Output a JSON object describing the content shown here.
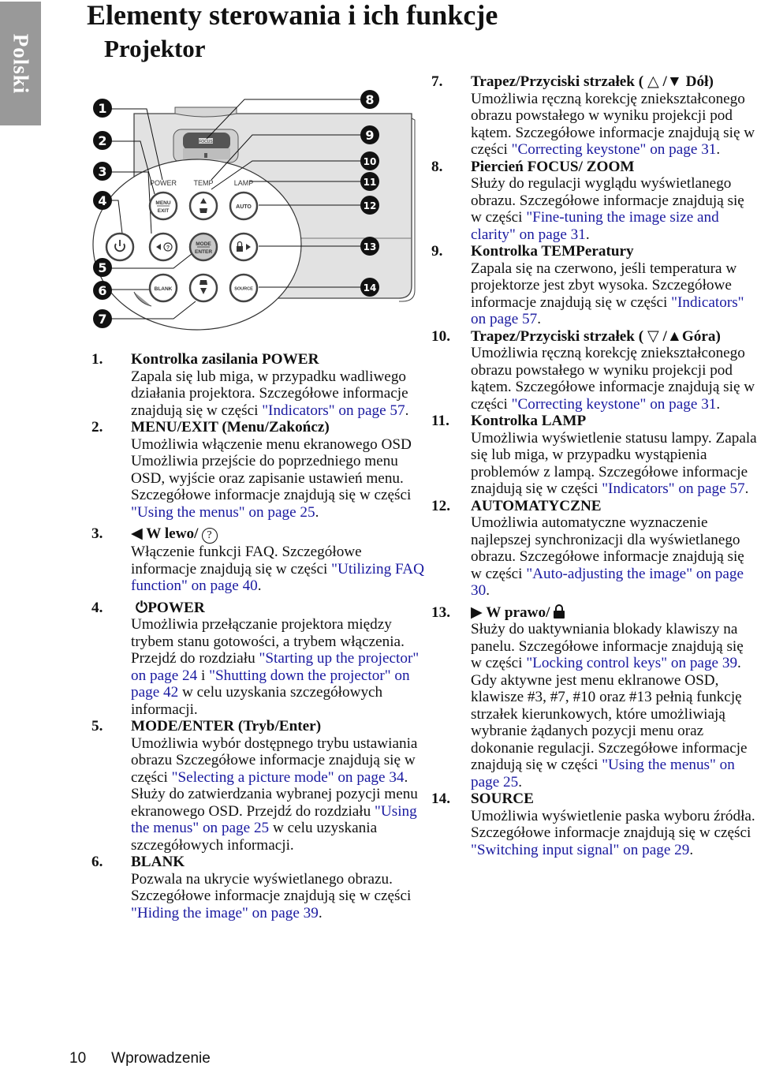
{
  "sidebar": {
    "language_tab": "Polski"
  },
  "header": {
    "title": "Elementy sterowania i ich funkcje",
    "subtitle": "Projektor"
  },
  "diagram": {
    "panel_labels": {
      "power": "POWER",
      "temp": "TEMP",
      "lamp": "LAMP",
      "focus": "FOCUS"
    },
    "buttons": {
      "menu_top": "MENU",
      "menu_bottom": "EXIT",
      "auto": "AUTO",
      "mode_top": "MODE",
      "mode_bottom": "ENTER",
      "blank": "BLANK",
      "source": "SOURCE"
    },
    "callouts": [
      "1",
      "2",
      "3",
      "4",
      "5",
      "6",
      "7",
      "8",
      "9",
      "10",
      "11",
      "12",
      "13",
      "14"
    ]
  },
  "items": [
    {
      "num": "1.",
      "title": "Kontrolka zasilania POWER",
      "body": "Zapala się lub miga, w przypadku wadliwego działania projektora. Szczegółowe informacje znajdują się w części ",
      "link": "\"Indicators\" on page 57",
      "tail": "."
    },
    {
      "num": "2.",
      "title": "MENU/EXIT (Menu/Zakończ)",
      "body": "Umożliwia włączenie menu ekranowego OSD Umożliwia przejście do poprzedniego menu OSD, wyjście oraz zapisanie ustawień menu.",
      "body2": "Szczegółowe informacje znajdują się w części ",
      "link": "\"Using the menus\" on page 25",
      "tail": "."
    },
    {
      "num": "3.",
      "title": "W lewo/",
      "body": "Włączenie funkcji FAQ. Szczegółowe informacje znajdują się w części ",
      "link": "\"Utilizing FAQ function\" on page 40",
      "tail": "."
    },
    {
      "num": "4.",
      "title": "POWER",
      "body": "Umożliwia przełączanie projektora między trybem stanu gotowości, a trybem włączenia. Przejdź do rozdziału ",
      "link": "\"Starting up the projector\" on page 24",
      "mid": "  i ",
      "link2": "\"Shutting down the projector\" on page 42",
      "tail": " w celu uzyskania szczegółowych informacji."
    },
    {
      "num": "5.",
      "title": "MODE/ENTER (Tryb/Enter)",
      "body": "Umożliwia wybór dostępnego trybu ustawiania obrazu Szczegółowe informacje znajdują się w części ",
      "link": "\"Selecting a picture mode\" on page 34",
      "tail": ".",
      "body2": "Służy do zatwierdzania wybranej pozycji menu ekranowego OSD. Przejdź do rozdziału ",
      "link2": "\"Using the menus\" on page 25",
      "tail2": " w celu uzyskania szczegółowych informacji."
    },
    {
      "num": "6.",
      "title": "BLANK",
      "body": "Pozwala na ukrycie wyświetlanego obrazu. Szczegółowe informacje znajdują się w części ",
      "link": "\"Hiding the image\" on page 39",
      "tail": "."
    },
    {
      "num": "7.",
      "title_pre": "Trapez/Przyciski strzałek (",
      "title_post": " Dół)",
      "body": "Umożliwia ręczną korekcję zniekształconego obrazu powstałego w wyniku projekcji pod kątem. Szczegółowe informacje znajdują się w części ",
      "link": "\"Correcting keystone\" on page 31",
      "tail": "."
    },
    {
      "num": "8.",
      "title": "Piercień FOCUS/ ZOOM",
      "body": "Służy do regulacji wyglądu wyświetlanego obrazu. Szczegółowe informacje znajdują się w części ",
      "link": "\"Fine-tuning the image size and clarity\" on page 31",
      "tail": "."
    },
    {
      "num": "9.",
      "title": "Kontrolka TEMPeratury",
      "body": "Zapala się na czerwono, jeśli temperatura w projektorze jest zbyt wysoka. Szczegółowe informacje znajdują się w części ",
      "link": "\"Indicators\" on page 57",
      "tail": "."
    },
    {
      "num": "10.",
      "title_pre": "Trapez/Przyciski strzałek (",
      "title_post": "Góra)",
      "body": "Umożliwia ręczną korekcję zniekształconego obrazu powstałego w wyniku projekcji pod kątem. Szczegółowe informacje znajdują się w części ",
      "link": "\"Correcting keystone\" on page 31",
      "tail": "."
    },
    {
      "num": "11.",
      "title": "Kontrolka LAMP",
      "body": "Umożliwia wyświetlenie statusu lampy. Zapala się lub miga, w przypadku wystąpienia problemów z lampą. Szczegółowe informacje znajdują się w części ",
      "link": "\"Indicators\" on page 57",
      "tail": "."
    },
    {
      "num": "12.",
      "title": "AUTOMATYCZNE",
      "body": "Umożliwia automatyczne wyznaczenie najlepszej synchronizacji dla wyświetlanego obrazu. Szczegółowe informacje znajdują się w części ",
      "link": "\"Auto-adjusting the image\" on page 30",
      "tail": "."
    },
    {
      "num": "13.",
      "title": "W prawo/",
      "body": "Służy do uaktywniania blokady klawiszy na panelu. Szczegółowe informacje znajdują się w części ",
      "link": "\"Locking control keys\" on page 39",
      "tail": ".",
      "body2": "Gdy aktywne jest menu eklranowe OSD, klawisze  #3,  #7, #10 oraz #13 pełnią funkcję strzałek kierunkowych, które umożliwiają wybranie żądanych pozycji menu oraz dokonanie regulacji. Szczegółowe informacje znajdują się w części ",
      "link2": "\"Using the menus\" on page 25",
      "tail2": "."
    },
    {
      "num": "14.",
      "title": "SOURCE",
      "body": "Umożliwia wyświetlenie paska wyboru źródła. Szczegółowe informacje znajdują się w części ",
      "link": "\"Switching input signal\" on page 29",
      "tail": "."
    }
  ],
  "footer": {
    "page_number": "10",
    "section": "Wprowadzenie"
  },
  "colors": {
    "link": "#1a1aa0",
    "tab_bg": "#999999",
    "panel_bg": "#e2e2e2",
    "mode_button": "#c8c8c8"
  }
}
